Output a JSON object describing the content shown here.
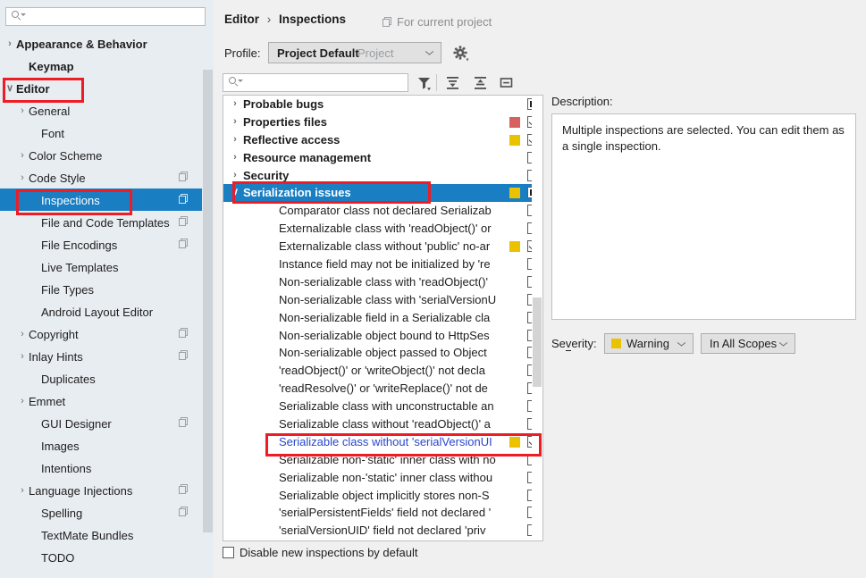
{
  "sidebar": {
    "search_placeholder": "",
    "search_value": "",
    "search_icon": "search-icon",
    "items": [
      {
        "label": "Appearance & Behavior",
        "chevron": "›",
        "bold": true,
        "indent": 0,
        "selected": false,
        "copy": false
      },
      {
        "label": "Keymap",
        "chevron": "",
        "bold": true,
        "indent": 1,
        "selected": false,
        "copy": false
      },
      {
        "label": "Editor",
        "chevron": "∨",
        "bold": true,
        "indent": 0,
        "selected": false,
        "copy": false
      },
      {
        "label": "General",
        "chevron": "›",
        "bold": false,
        "indent": 1,
        "selected": false,
        "copy": false
      },
      {
        "label": "Font",
        "chevron": "",
        "bold": false,
        "indent": 2,
        "selected": false,
        "copy": false
      },
      {
        "label": "Color Scheme",
        "chevron": "›",
        "bold": false,
        "indent": 1,
        "selected": false,
        "copy": false
      },
      {
        "label": "Code Style",
        "chevron": "›",
        "bold": false,
        "indent": 1,
        "selected": false,
        "copy": true
      },
      {
        "label": "Inspections",
        "chevron": "",
        "bold": false,
        "indent": 2,
        "selected": true,
        "copy": true
      },
      {
        "label": "File and Code Templates",
        "chevron": "",
        "bold": false,
        "indent": 2,
        "selected": false,
        "copy": true
      },
      {
        "label": "File Encodings",
        "chevron": "",
        "bold": false,
        "indent": 2,
        "selected": false,
        "copy": true
      },
      {
        "label": "Live Templates",
        "chevron": "",
        "bold": false,
        "indent": 2,
        "selected": false,
        "copy": false
      },
      {
        "label": "File Types",
        "chevron": "",
        "bold": false,
        "indent": 2,
        "selected": false,
        "copy": false
      },
      {
        "label": "Android Layout Editor",
        "chevron": "",
        "bold": false,
        "indent": 2,
        "selected": false,
        "copy": false
      },
      {
        "label": "Copyright",
        "chevron": "›",
        "bold": false,
        "indent": 1,
        "selected": false,
        "copy": true
      },
      {
        "label": "Inlay Hints",
        "chevron": "›",
        "bold": false,
        "indent": 1,
        "selected": false,
        "copy": true
      },
      {
        "label": "Duplicates",
        "chevron": "",
        "bold": false,
        "indent": 2,
        "selected": false,
        "copy": false
      },
      {
        "label": "Emmet",
        "chevron": "›",
        "bold": false,
        "indent": 1,
        "selected": false,
        "copy": false
      },
      {
        "label": "GUI Designer",
        "chevron": "",
        "bold": false,
        "indent": 2,
        "selected": false,
        "copy": true
      },
      {
        "label": "Images",
        "chevron": "",
        "bold": false,
        "indent": 2,
        "selected": false,
        "copy": false
      },
      {
        "label": "Intentions",
        "chevron": "",
        "bold": false,
        "indent": 2,
        "selected": false,
        "copy": false
      },
      {
        "label": "Language Injections",
        "chevron": "›",
        "bold": false,
        "indent": 1,
        "selected": false,
        "copy": true
      },
      {
        "label": "Spelling",
        "chevron": "",
        "bold": false,
        "indent": 2,
        "selected": false,
        "copy": true
      },
      {
        "label": "TextMate Bundles",
        "chevron": "",
        "bold": false,
        "indent": 2,
        "selected": false,
        "copy": false
      },
      {
        "label": "TODO",
        "chevron": "",
        "bold": false,
        "indent": 2,
        "selected": false,
        "copy": false
      }
    ]
  },
  "header": {
    "breadcrumb_root": "Editor",
    "breadcrumb_sep": "›",
    "breadcrumb_leaf": "Inspections",
    "for_current_project": "For current project"
  },
  "profile": {
    "label": "Profile:",
    "name": "Project Default",
    "scope": "Project",
    "gear_icon": "gear-icon"
  },
  "toolbar": {
    "search_placeholder": "",
    "search_value": "",
    "filter_icon": "filter-icon",
    "expand_all_icon": "expand-all-icon",
    "collapse_all_icon": "collapse-all-icon",
    "group_by_icon": "group-by-severity-icon"
  },
  "inspections": [
    {
      "label": "Probable bugs",
      "type": "group",
      "chevron": "›",
      "severity": "",
      "check": "partial",
      "selected": false,
      "highlight": false
    },
    {
      "label": "Properties files",
      "type": "group",
      "chevron": "›",
      "severity": "error",
      "check": "checked",
      "selected": false,
      "highlight": false
    },
    {
      "label": "Reflective access",
      "type": "group",
      "chevron": "›",
      "severity": "warn",
      "check": "checked",
      "selected": false,
      "highlight": false
    },
    {
      "label": "Resource management",
      "type": "group",
      "chevron": "›",
      "severity": "",
      "check": "empty",
      "selected": false,
      "highlight": false
    },
    {
      "label": "Security",
      "type": "group",
      "chevron": "›",
      "severity": "",
      "check": "empty",
      "selected": false,
      "highlight": false
    },
    {
      "label": "Serialization issues",
      "type": "group",
      "chevron": "∨",
      "severity": "warn",
      "check": "partial",
      "selected": true,
      "highlight": false
    },
    {
      "label": "Comparator class not declared Serializab",
      "type": "leaf",
      "severity": "",
      "check": "empty",
      "selected": false,
      "highlight": false
    },
    {
      "label": "Externalizable class with 'readObject()' or",
      "type": "leaf",
      "severity": "",
      "check": "empty",
      "selected": false,
      "highlight": false
    },
    {
      "label": "Externalizable class without 'public' no-ar",
      "type": "leaf",
      "severity": "warn",
      "check": "checked",
      "selected": false,
      "highlight": false
    },
    {
      "label": "Instance field may not be initialized by 're",
      "type": "leaf",
      "severity": "",
      "check": "empty",
      "selected": false,
      "highlight": false
    },
    {
      "label": "Non-serializable class with 'readObject()'",
      "type": "leaf",
      "severity": "",
      "check": "empty",
      "selected": false,
      "highlight": false
    },
    {
      "label": "Non-serializable class with 'serialVersionU",
      "type": "leaf",
      "severity": "",
      "check": "empty",
      "selected": false,
      "highlight": false
    },
    {
      "label": "Non-serializable field in a Serializable cla",
      "type": "leaf",
      "severity": "",
      "check": "empty",
      "selected": false,
      "highlight": false
    },
    {
      "label": "Non-serializable object bound to HttpSes",
      "type": "leaf",
      "severity": "",
      "check": "empty",
      "selected": false,
      "highlight": false
    },
    {
      "label": "Non-serializable object passed to Object",
      "type": "leaf",
      "severity": "",
      "check": "empty",
      "selected": false,
      "highlight": false
    },
    {
      "label": "'readObject()' or 'writeObject()' not decla",
      "type": "leaf",
      "severity": "",
      "check": "empty",
      "selected": false,
      "highlight": false
    },
    {
      "label": "'readResolve()' or 'writeReplace()' not de",
      "type": "leaf",
      "severity": "",
      "check": "empty",
      "selected": false,
      "highlight": false
    },
    {
      "label": "Serializable class with unconstructable an",
      "type": "leaf",
      "severity": "",
      "check": "empty",
      "selected": false,
      "highlight": false
    },
    {
      "label": "Serializable class without 'readObject()' a",
      "type": "leaf",
      "severity": "",
      "check": "empty",
      "selected": false,
      "highlight": false
    },
    {
      "label": "Serializable class without 'serialVersionUI",
      "type": "leaf",
      "severity": "warn",
      "check": "checked",
      "selected": false,
      "highlight": true
    },
    {
      "label": "Serializable non-'static' inner class with no",
      "type": "leaf",
      "severity": "",
      "check": "empty",
      "selected": false,
      "highlight": false
    },
    {
      "label": "Serializable non-'static' inner class withou",
      "type": "leaf",
      "severity": "",
      "check": "empty",
      "selected": false,
      "highlight": false
    },
    {
      "label": "Serializable object implicitly stores non-S",
      "type": "leaf",
      "severity": "",
      "check": "empty",
      "selected": false,
      "highlight": false
    },
    {
      "label": "'serialPersistentFields' field not declared '",
      "type": "leaf",
      "severity": "",
      "check": "empty",
      "selected": false,
      "highlight": false
    },
    {
      "label": "'serialVersionUID' field not declared 'priv",
      "type": "leaf",
      "severity": "",
      "check": "empty",
      "selected": false,
      "highlight": false
    }
  ],
  "footer": {
    "disable_new_label": "Disable new inspections by default",
    "disable_new_checked": false
  },
  "description": {
    "label": "Description:",
    "text": "Multiple inspections are selected. You can edit them as a single inspection."
  },
  "severity": {
    "label_prefix": "Se",
    "label_underline": "v",
    "label_suffix": "erity:",
    "value": "Warning",
    "scope_value": "In All Scopes"
  },
  "colors": {
    "selection_blue": "#1a7ec2",
    "warning_yellow": "#eac200",
    "error_red": "#d6615e",
    "annotation_red": "#ee1c25",
    "sidebar_bg": "#e8edf2",
    "panel_bg": "#f0f0f0"
  }
}
